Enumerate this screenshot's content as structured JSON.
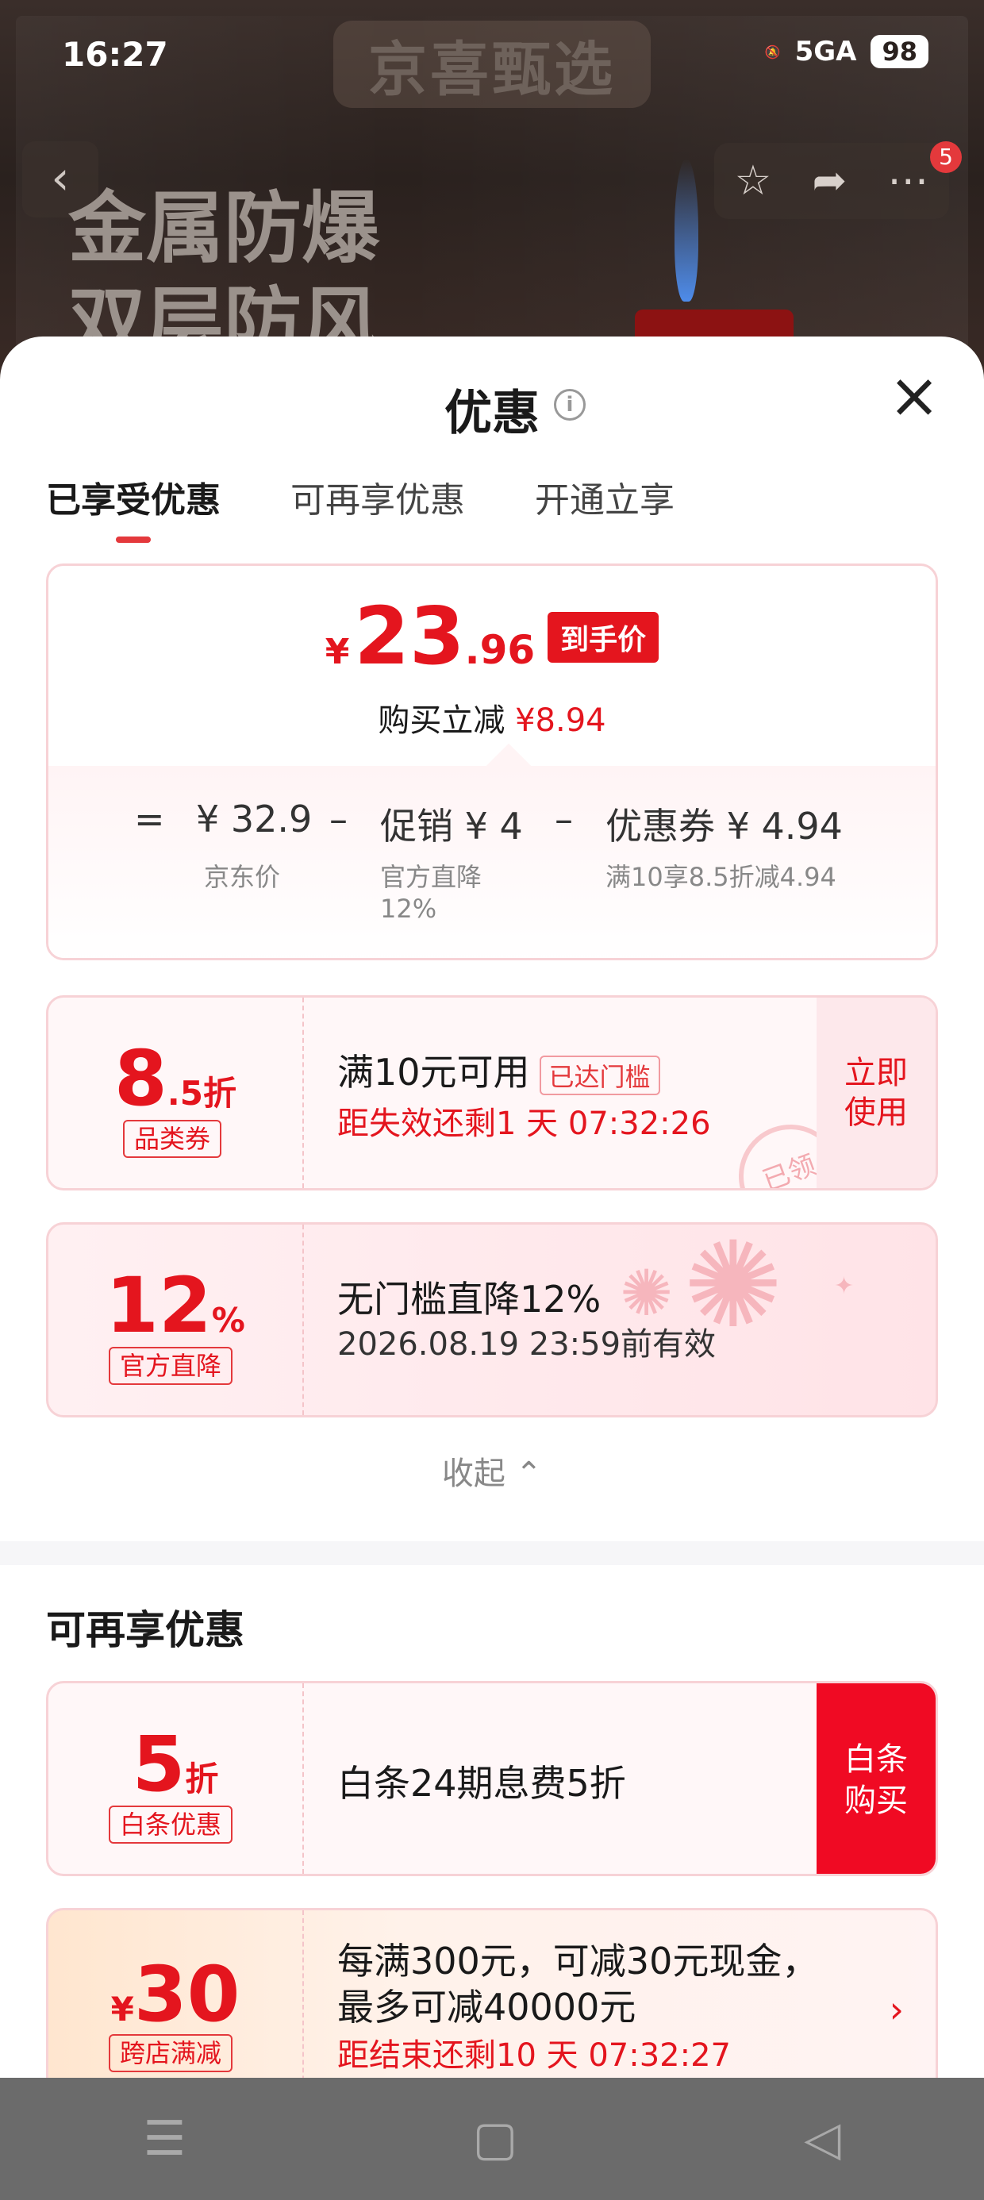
{
  "status_bar": {
    "time": "16:27",
    "signal": "5GA",
    "battery": "98"
  },
  "background_page": {
    "brand": "京喜甄选",
    "hero_line1": "金属防爆",
    "hero_line2": "双层防风",
    "notification_count": "5",
    "icons": [
      "back-icon",
      "star-icon",
      "share-icon",
      "more-icon"
    ]
  },
  "sheet": {
    "title": "优惠",
    "close": "×",
    "tabs": [
      {
        "label": "已享受优惠",
        "active": true
      },
      {
        "label": "可再享优惠",
        "active": false
      },
      {
        "label": "开通立享",
        "active": false
      }
    ],
    "price_card": {
      "currency": "¥",
      "price_int": "23",
      "price_dec": ".96",
      "price_tag": "到手价",
      "save_text": "购买立减",
      "save_amount": "¥8.94",
      "formula": {
        "eq": "=",
        "jd_price": "¥ 32.9",
        "jd_price_label": "京东价",
        "minus1": "–",
        "promo": "促销 ¥ 4",
        "promo_label_1": "官方直降",
        "promo_label_2": "12%",
        "minus2": "–",
        "coupon": "优惠券 ¥ 4.94",
        "coupon_label": "满10享8.5折减4.94"
      }
    },
    "coupons": [
      {
        "value": "8",
        "unit": ".5折",
        "chip": "品类券",
        "title": "满10元可用",
        "tag": "已达门槛",
        "subtitle": "距失效还剩1 天 07:32:26",
        "action": [
          "立即",
          "使用"
        ],
        "stamp": "已领"
      },
      {
        "value": "12",
        "unit": "%",
        "chip": "官方直降",
        "title": "无门槛直降12%",
        "subtitle": "2026.08.19 23:59前有效"
      }
    ],
    "collapse_label": "收起 ⌃",
    "section_title": "可再享优惠",
    "more_offers": [
      {
        "value": "5",
        "unit": "折",
        "chip": "白条优惠",
        "title": "白条24期息费5折",
        "action": [
          "白条",
          "购买"
        ]
      },
      {
        "prefix": "¥",
        "value": "30",
        "chip": "跨店满减",
        "title_1": "每满300元，可减30元现金，",
        "title_2": "最多可减40000元",
        "subtitle": "距结束还剩10 天 07:32:27",
        "arrow": "›"
      }
    ]
  },
  "system_nav": {
    "menu": "☰",
    "home": "▢",
    "back": "◁"
  }
}
